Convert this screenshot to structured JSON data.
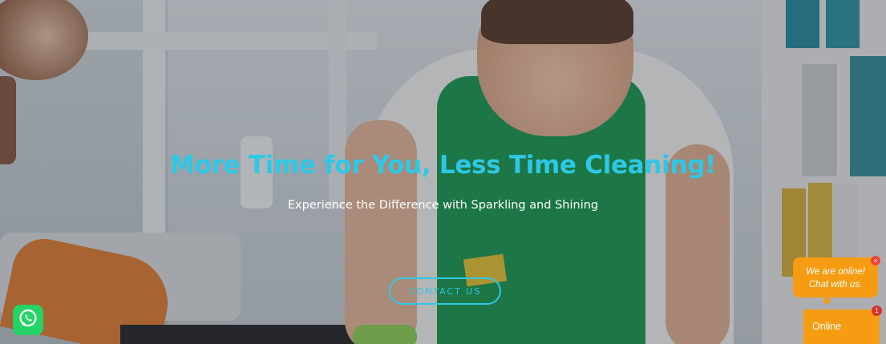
{
  "hero": {
    "headline": "More Time for You, Less Time Cleaning!",
    "subheadline": "Experience the Difference with Sparkling and Shining",
    "cta_label": "CONTACT US"
  },
  "widgets": {
    "chat_bubble_line1": "We are online!",
    "chat_bubble_line2": "Chat with us.",
    "online_label": "Online",
    "unread_count": "1",
    "close_glyph": "×"
  },
  "icons": {
    "whatsapp": "whatsapp-icon"
  },
  "colors": {
    "headline": "#2ec8e6",
    "cta_border": "#2ec8e6",
    "chat_orange": "#f59c12",
    "whatsapp_green": "#25d366",
    "badge_red": "#d6322a",
    "apron_green": "#1f9a55"
  }
}
